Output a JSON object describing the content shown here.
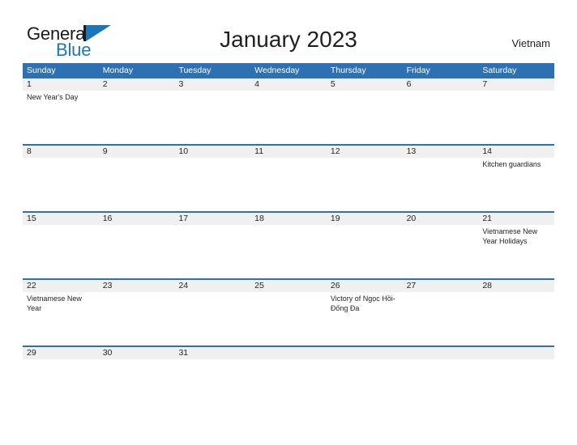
{
  "brand": {
    "name_part1": "General",
    "name_part2": "Blue",
    "triangle_icon": "triangle-icon"
  },
  "header": {
    "title": "January 2023",
    "country": "Vietnam"
  },
  "colors": {
    "header_blue": "#2e71b2",
    "brand_blue": "#1b75bb",
    "daynum_band": "#f0f0f0",
    "text": "#231f20"
  },
  "calendar": {
    "month": "January",
    "year": "2023",
    "weekday_headers": [
      "Sunday",
      "Monday",
      "Tuesday",
      "Wednesday",
      "Thursday",
      "Friday",
      "Saturday"
    ],
    "weeks": [
      [
        {
          "day": "1",
          "event": "New Year's Day"
        },
        {
          "day": "2",
          "event": ""
        },
        {
          "day": "3",
          "event": ""
        },
        {
          "day": "4",
          "event": ""
        },
        {
          "day": "5",
          "event": ""
        },
        {
          "day": "6",
          "event": ""
        },
        {
          "day": "7",
          "event": ""
        }
      ],
      [
        {
          "day": "8",
          "event": ""
        },
        {
          "day": "9",
          "event": ""
        },
        {
          "day": "10",
          "event": ""
        },
        {
          "day": "11",
          "event": ""
        },
        {
          "day": "12",
          "event": ""
        },
        {
          "day": "13",
          "event": ""
        },
        {
          "day": "14",
          "event": "Kitchen guardians"
        }
      ],
      [
        {
          "day": "15",
          "event": ""
        },
        {
          "day": "16",
          "event": ""
        },
        {
          "day": "17",
          "event": ""
        },
        {
          "day": "18",
          "event": ""
        },
        {
          "day": "19",
          "event": ""
        },
        {
          "day": "20",
          "event": ""
        },
        {
          "day": "21",
          "event": "Vietnamese New Year Holidays"
        }
      ],
      [
        {
          "day": "22",
          "event": "Vietnamese New Year"
        },
        {
          "day": "23",
          "event": ""
        },
        {
          "day": "24",
          "event": ""
        },
        {
          "day": "25",
          "event": ""
        },
        {
          "day": "26",
          "event": "Victory of Ngọc Hồi-Đống Đa"
        },
        {
          "day": "27",
          "event": ""
        },
        {
          "day": "28",
          "event": ""
        }
      ],
      [
        {
          "day": "29",
          "event": ""
        },
        {
          "day": "30",
          "event": ""
        },
        {
          "day": "31",
          "event": ""
        },
        {
          "day": "",
          "event": ""
        },
        {
          "day": "",
          "event": ""
        },
        {
          "day": "",
          "event": ""
        },
        {
          "day": "",
          "event": ""
        }
      ]
    ]
  }
}
